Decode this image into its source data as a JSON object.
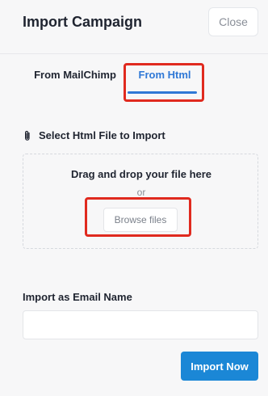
{
  "dialog": {
    "title": "Import Campaign",
    "close_label": "Close"
  },
  "tabs": [
    {
      "label": "From MailChimp",
      "active": false
    },
    {
      "label": "From Html",
      "active": true
    }
  ],
  "upload": {
    "section_label": "Select Html File to Import",
    "icon": "paperclip-icon",
    "drag_text": "Drag and drop your file here",
    "or_text": "or",
    "browse_label": "Browse files"
  },
  "email_name": {
    "label": "Import as Email Name",
    "value": "",
    "placeholder": ""
  },
  "actions": {
    "import_label": "Import Now"
  },
  "colors": {
    "accent": "#2f78d6",
    "primary_button": "#1b87d6",
    "highlight": "#e02a1f"
  }
}
